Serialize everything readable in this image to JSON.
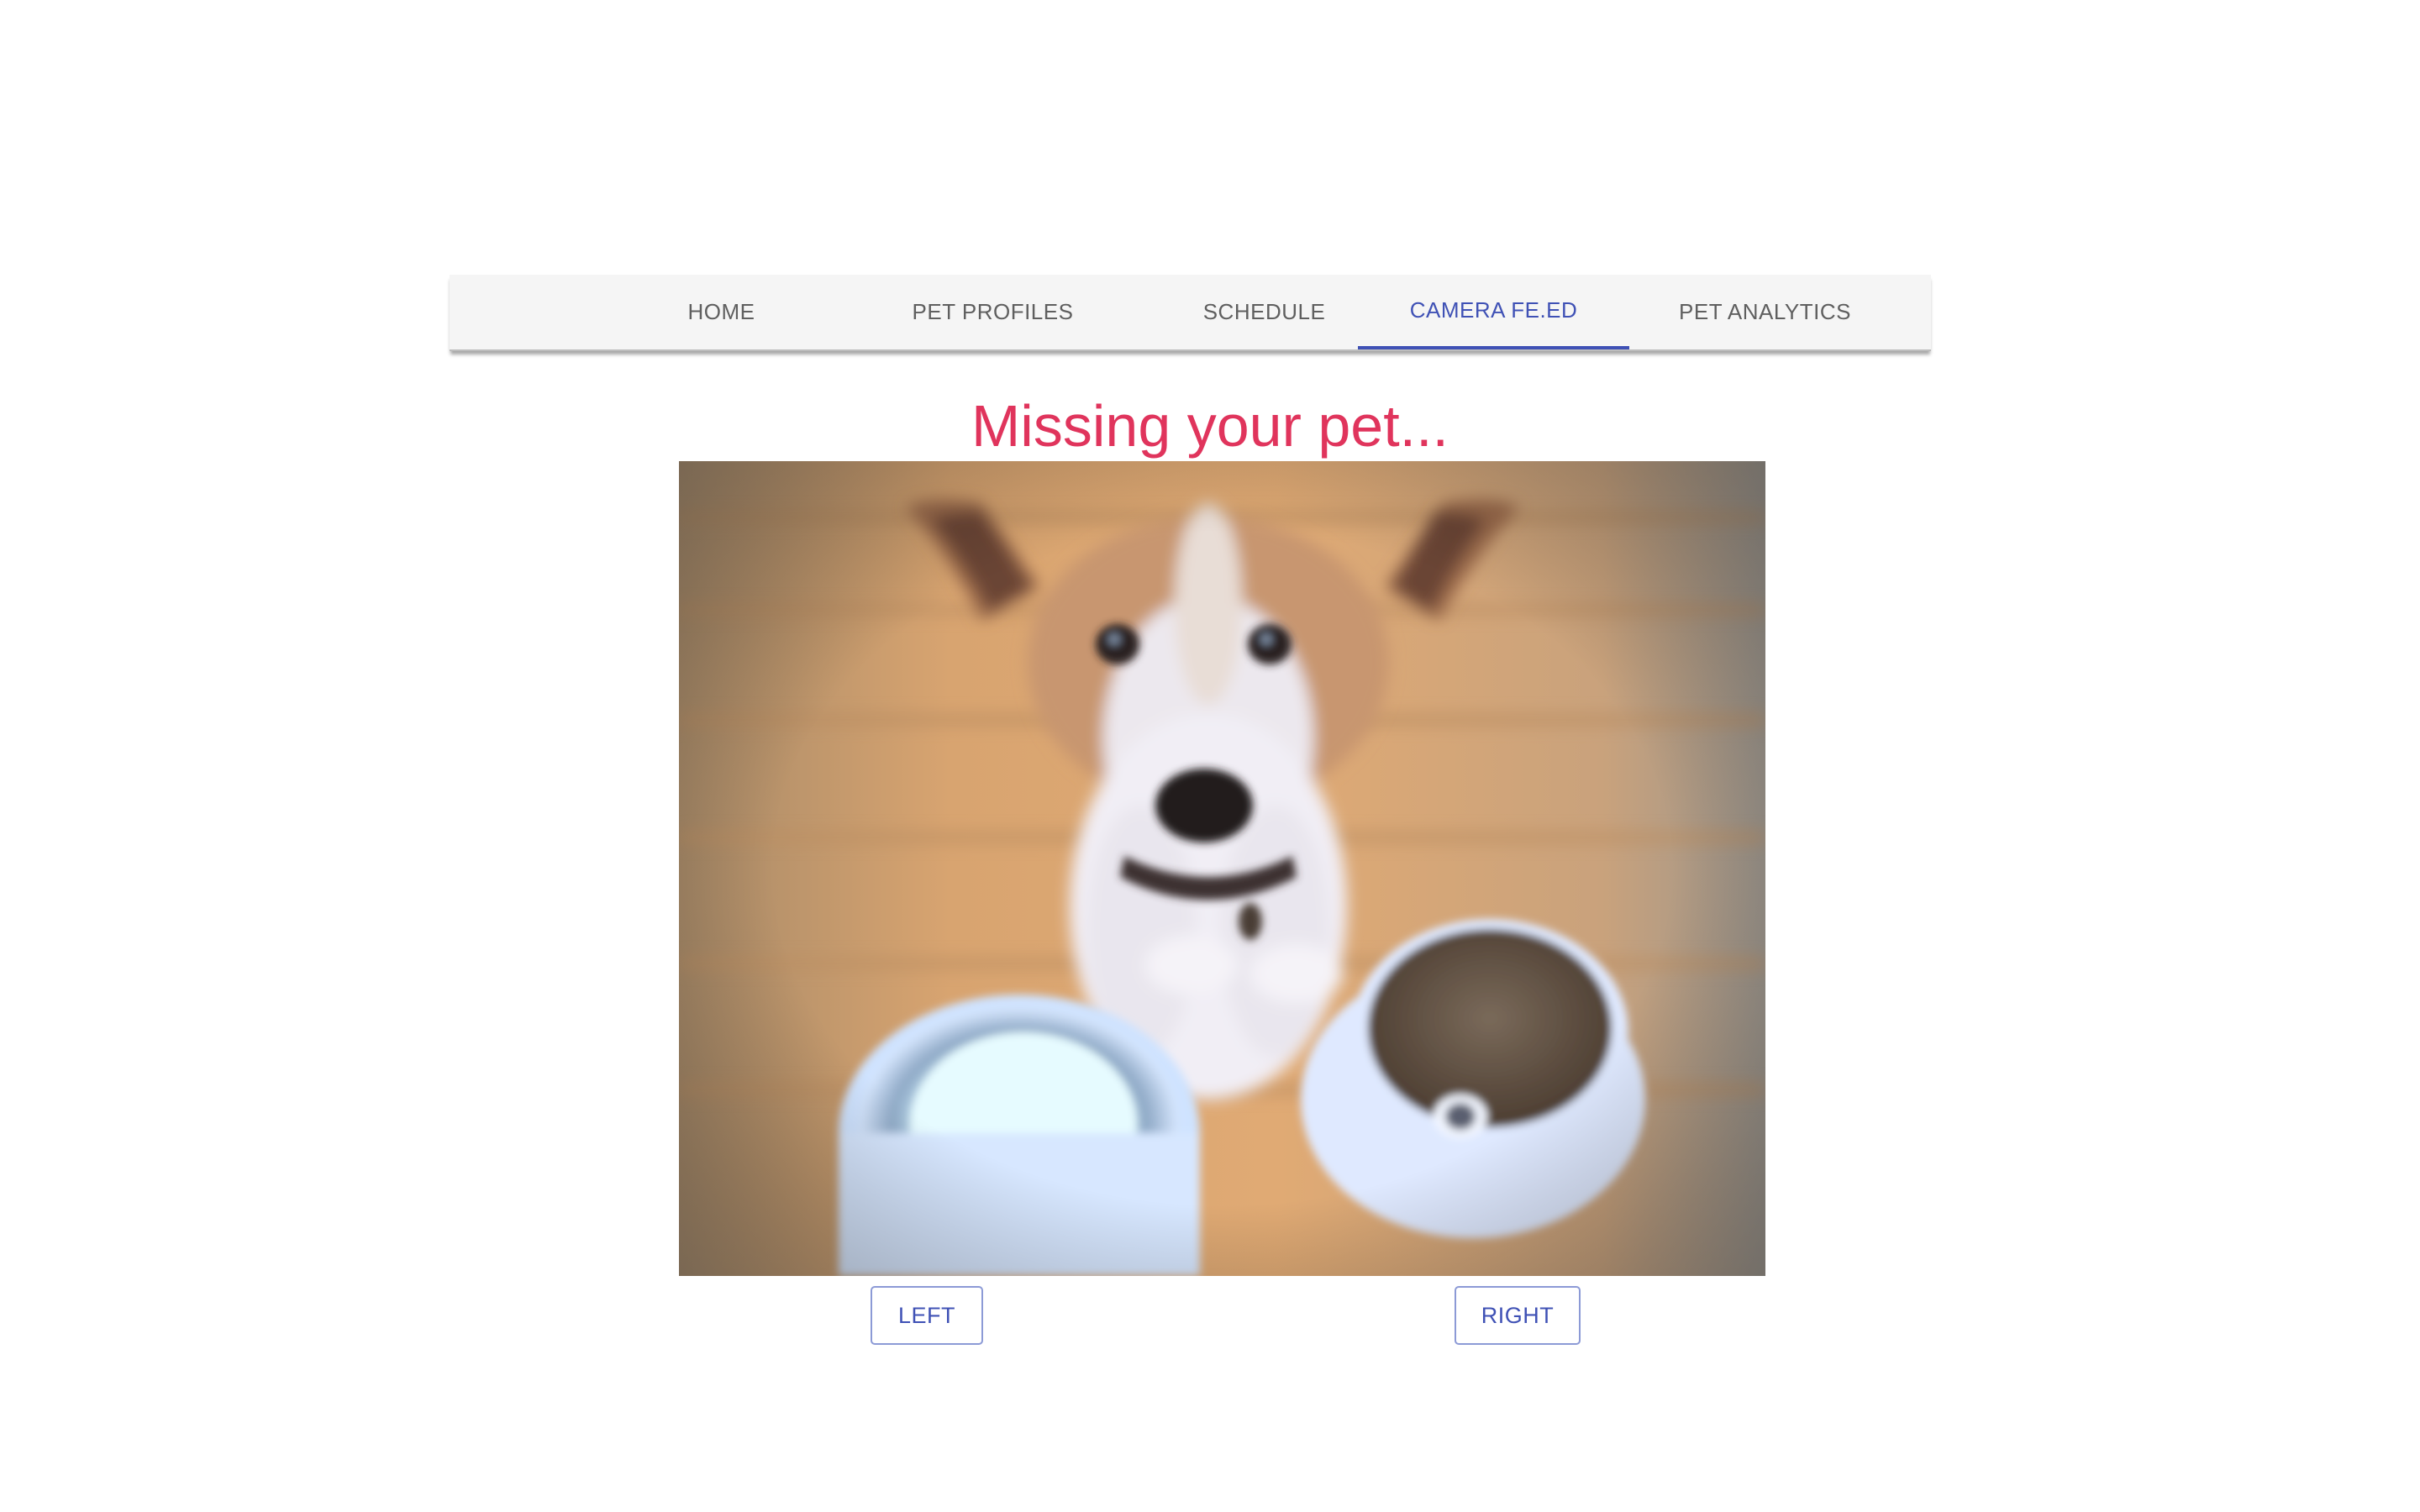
{
  "nav": {
    "tabs": [
      {
        "label": "HOME",
        "active": false
      },
      {
        "label": "PET PROFILES",
        "active": false
      },
      {
        "label": "SCHEDULE",
        "active": false
      },
      {
        "label": "CAMERA FE.ED",
        "active": true
      },
      {
        "label": "PET ANALYTICS",
        "active": false
      }
    ]
  },
  "main": {
    "title": "Missing your pet...",
    "controls": {
      "left_label": "LEFT",
      "right_label": "RIGHT"
    }
  },
  "colors": {
    "accent": "#3f51b5",
    "title": "#e0345c",
    "nav_bg": "#f5f5f5",
    "tab_text": "#5f5f5f"
  }
}
